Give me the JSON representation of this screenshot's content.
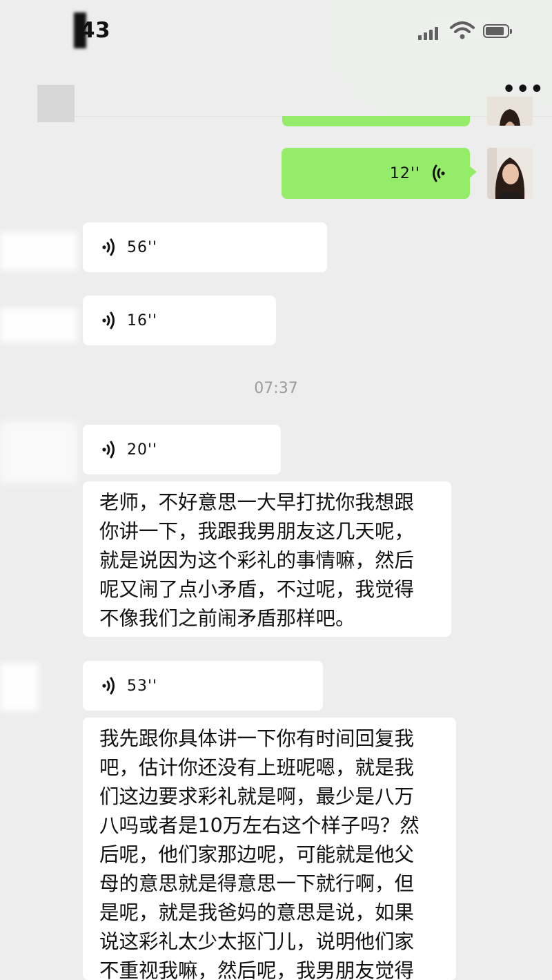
{
  "status_bar": {
    "time": "43"
  },
  "nav": {
    "more_label": "•••"
  },
  "messages": {
    "sent_voice": {
      "duration": "12''"
    },
    "voice_1": {
      "duration": "56''"
    },
    "voice_2": {
      "duration": "16''"
    },
    "timestamp": "07:37",
    "voice_3": {
      "duration": "20''"
    },
    "text_1": {
      "lines": [
        "老师，不好意思一大早打扰你我想跟",
        "你讲一下，我跟我男朋友这几天呢，",
        "就是说因为这个彩礼的事情嘛，然后",
        "呢又闹了点小矛盾，不过呢，我觉得",
        "不像我们之前闹矛盾那样吧。"
      ]
    },
    "voice_4": {
      "duration": "53''"
    },
    "text_2": {
      "lines": [
        "我先跟你具体讲一下你有时间回复我",
        "吧，估计你还没有上班呢嗯，就是我",
        "们这边要求彩礼就是啊，最少是八万",
        "八吗或者是10万左右这个样子吗？然",
        "后呢，他们家那边呢，可能就是他父",
        "母的意思就是得意思一下就行啊，但",
        "是呢，就是我爸妈的意思是说，如果",
        "说这彩礼太少太抠门儿，说明他们家",
        "不重视我嘛，然后呢，我男朋友觉得"
      ]
    }
  },
  "colors": {
    "background": "#ededed",
    "sent_bubble": "#95ec69",
    "received_bubble": "#ffffff",
    "timestamp": "#9b9b9b"
  },
  "icons": [
    "signal-icon",
    "wifi-icon",
    "battery-icon",
    "more-icon",
    "voice-wave-icon"
  ]
}
